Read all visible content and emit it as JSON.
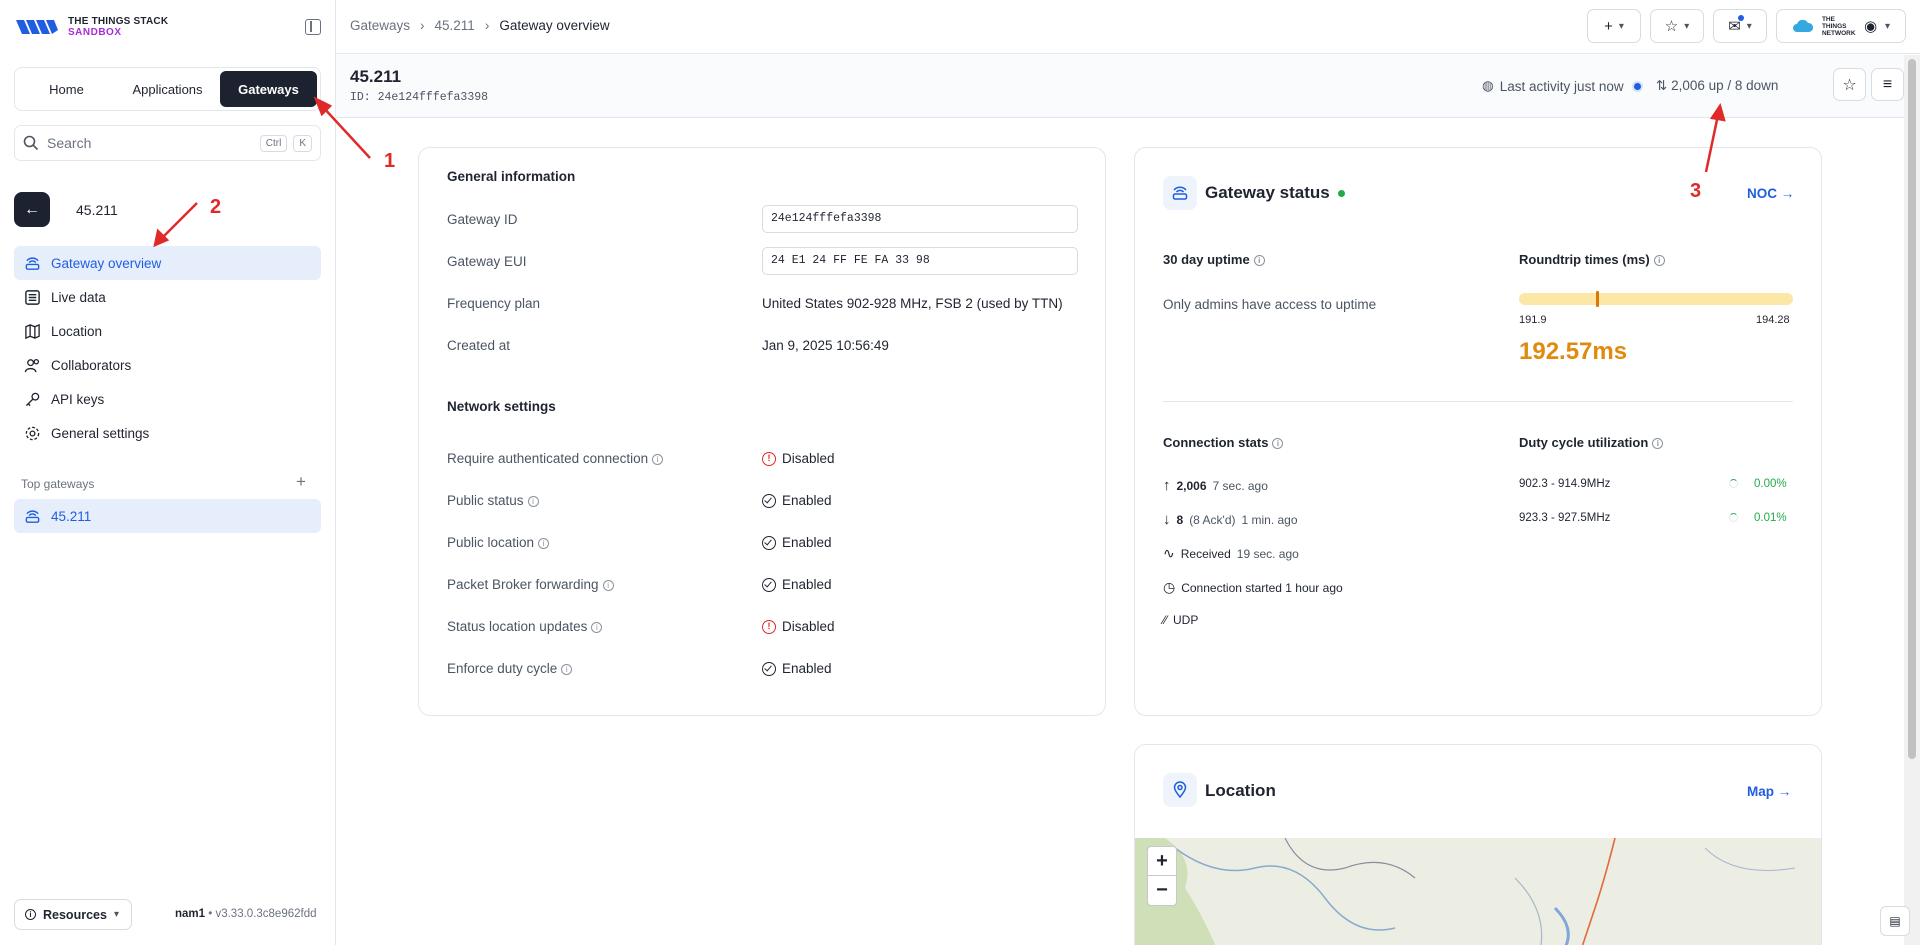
{
  "brand": {
    "line1": "THE THINGS STACK",
    "line2": "SANDBOX"
  },
  "tabs": [
    {
      "label": "Home"
    },
    {
      "label": "Applications"
    },
    {
      "label": "Gateways"
    }
  ],
  "search": {
    "placeholder": "Search",
    "kbd1": "Ctrl",
    "kbd2": "K"
  },
  "context": {
    "title": "45.211"
  },
  "nav": [
    {
      "label": "Gateway overview",
      "icon": "gateway-icon"
    },
    {
      "label": "Live data",
      "icon": "list-icon"
    },
    {
      "label": "Location",
      "icon": "map-icon"
    },
    {
      "label": "Collaborators",
      "icon": "users-icon"
    },
    {
      "label": "API keys",
      "icon": "key-icon"
    },
    {
      "label": "General settings",
      "icon": "gear-icon"
    }
  ],
  "top_gateways": {
    "label": "Top gateways",
    "items": [
      {
        "label": "45.211"
      }
    ]
  },
  "footer": {
    "resources": "Resources",
    "cluster": "nam1",
    "version": "v3.33.0.3c8e962fdd"
  },
  "breadcrumb": {
    "c1": "Gateways",
    "c2": "45.211",
    "c3": "Gateway overview"
  },
  "topbar": {
    "network_logo": "THE THINGS NETWORK"
  },
  "header": {
    "name": "45.211",
    "id": "ID: 24e124fffefa3398",
    "activity": "Last activity just now",
    "updown": "2,006 up / 8 down"
  },
  "general": {
    "title": "General information",
    "rows": [
      {
        "label": "Gateway ID",
        "value": "24e124fffefa3398"
      },
      {
        "label": "Gateway EUI",
        "value": "24 E1 24 FF FE FA 33 98"
      },
      {
        "label": "Frequency plan",
        "value": "United States 902-928 MHz, FSB 2 (used by TTN)"
      },
      {
        "label": "Created at",
        "value": "Jan 9, 2025 10:56:49"
      }
    ],
    "network_title": "Network settings",
    "network": [
      {
        "label": "Require authenticated connection",
        "value": "Disabled",
        "state": "off"
      },
      {
        "label": "Public status",
        "value": "Enabled",
        "state": "on"
      },
      {
        "label": "Public location",
        "value": "Enabled",
        "state": "on"
      },
      {
        "label": "Packet Broker forwarding",
        "value": "Enabled",
        "state": "on"
      },
      {
        "label": "Status location updates",
        "value": "Disabled",
        "state": "off"
      },
      {
        "label": "Enforce duty cycle",
        "value": "Enabled",
        "state": "on"
      }
    ]
  },
  "status": {
    "title": "Gateway status",
    "noc_link": "NOC →",
    "uptime_title": "30 day uptime",
    "uptime_text": "Only admins have access to uptime",
    "rt_title": "Roundtrip times (ms)",
    "rt_min": "191.9",
    "rt_max": "194.28",
    "rt_value": "192.57ms",
    "rt_marker_fraction": 0.28,
    "conn_title": "Connection stats",
    "up_count": "2,006",
    "up_time": "7 sec. ago",
    "down_count": "8",
    "down_ack": "(8 Ack'd)",
    "down_time": "1 min. ago",
    "received_label": "Received",
    "received_time": "19 sec. ago",
    "conn_started": "Connection started 1 hour ago",
    "protocol": "UDP",
    "duty_title": "Duty cycle utilization",
    "duty": [
      {
        "band": "902.3 - 914.9MHz",
        "pct": "0.00%"
      },
      {
        "band": "923.3 - 927.5MHz",
        "pct": "0.01%"
      }
    ]
  },
  "location": {
    "title": "Location",
    "map_link": "Map →"
  },
  "annotations": {
    "n1": "1",
    "n2": "2",
    "n3": "3"
  },
  "colors": {
    "accent": "#1f5ee0",
    "dark": "#1d2230",
    "annotation": "#e02929",
    "success": "#23a94b",
    "warning": "#e08a0e"
  }
}
